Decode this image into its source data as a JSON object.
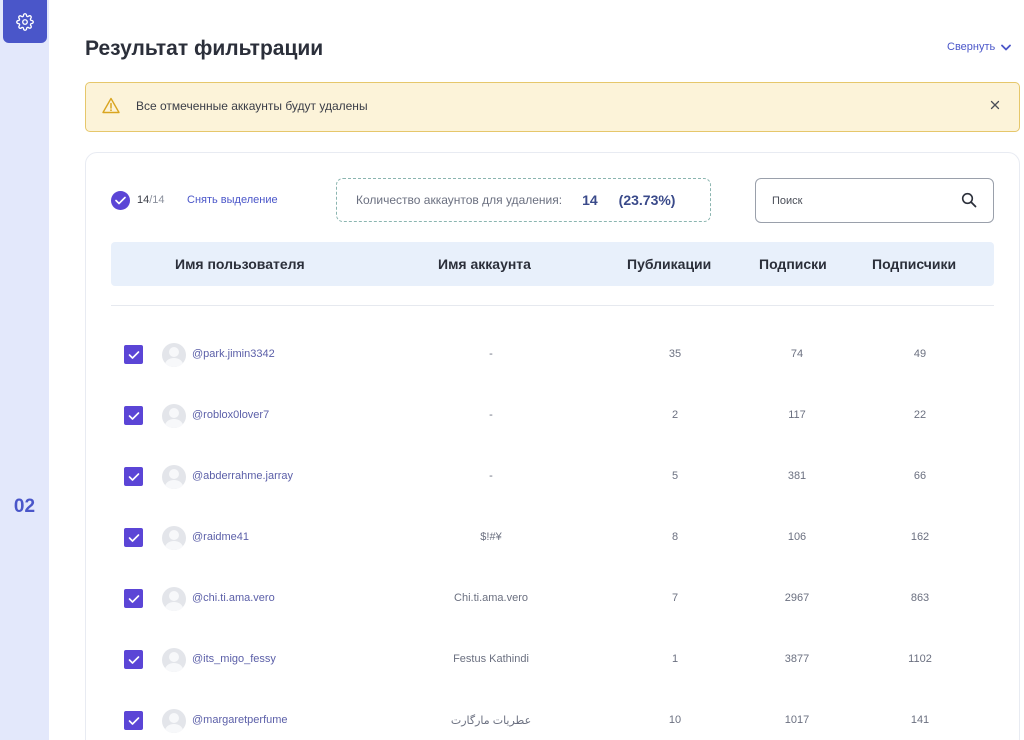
{
  "sidebar": {
    "step": "02",
    "gear_icon": "gear-icon"
  },
  "header": {
    "title": "Результат фильтрации",
    "collapse_label": "Свернуть"
  },
  "alert": {
    "text": "Все отмеченные аккаунты будут удалены",
    "icon": "warning-icon"
  },
  "selection": {
    "selected": "14",
    "total": "/14",
    "deselect_label": "Снять выделение"
  },
  "delete_summary": {
    "label": "Количество аккаунтов для удаления:",
    "count": "14",
    "percent": "(23.73%)"
  },
  "search": {
    "placeholder": "Поиск"
  },
  "table": {
    "columns": [
      "Имя пользователя",
      "Имя аккаунта",
      "Публикации",
      "Подписки",
      "Подписчики"
    ],
    "rows": [
      {
        "username": "@park.jimin3342",
        "account": "-",
        "posts": "35",
        "following": "74",
        "followers": "49"
      },
      {
        "username": "@roblox0lover7",
        "account": "-",
        "posts": "2",
        "following": "117",
        "followers": "22"
      },
      {
        "username": "@abderrahme.jarray",
        "account": "-",
        "posts": "5",
        "following": "381",
        "followers": "66"
      },
      {
        "username": "@raidme41",
        "account": "$!#¥",
        "posts": "8",
        "following": "106",
        "followers": "162"
      },
      {
        "username": "@chi.ti.ama.vero",
        "account": "Chi.ti.ama.vero",
        "posts": "7",
        "following": "2967",
        "followers": "863"
      },
      {
        "username": "@its_migo_fessy",
        "account": "Festus Kathindi",
        "posts": "1",
        "following": "3877",
        "followers": "1102"
      },
      {
        "username": "@margaretperfume",
        "account": "عطريات مارگارت",
        "posts": "10",
        "following": "1017",
        "followers": "141"
      }
    ]
  },
  "colors": {
    "accent": "#4a56c9",
    "checkbox": "#5b45d6",
    "alert_bg": "#fcf3d9",
    "alert_border": "#e6c76b",
    "table_header_bg": "#e8f0fb"
  }
}
